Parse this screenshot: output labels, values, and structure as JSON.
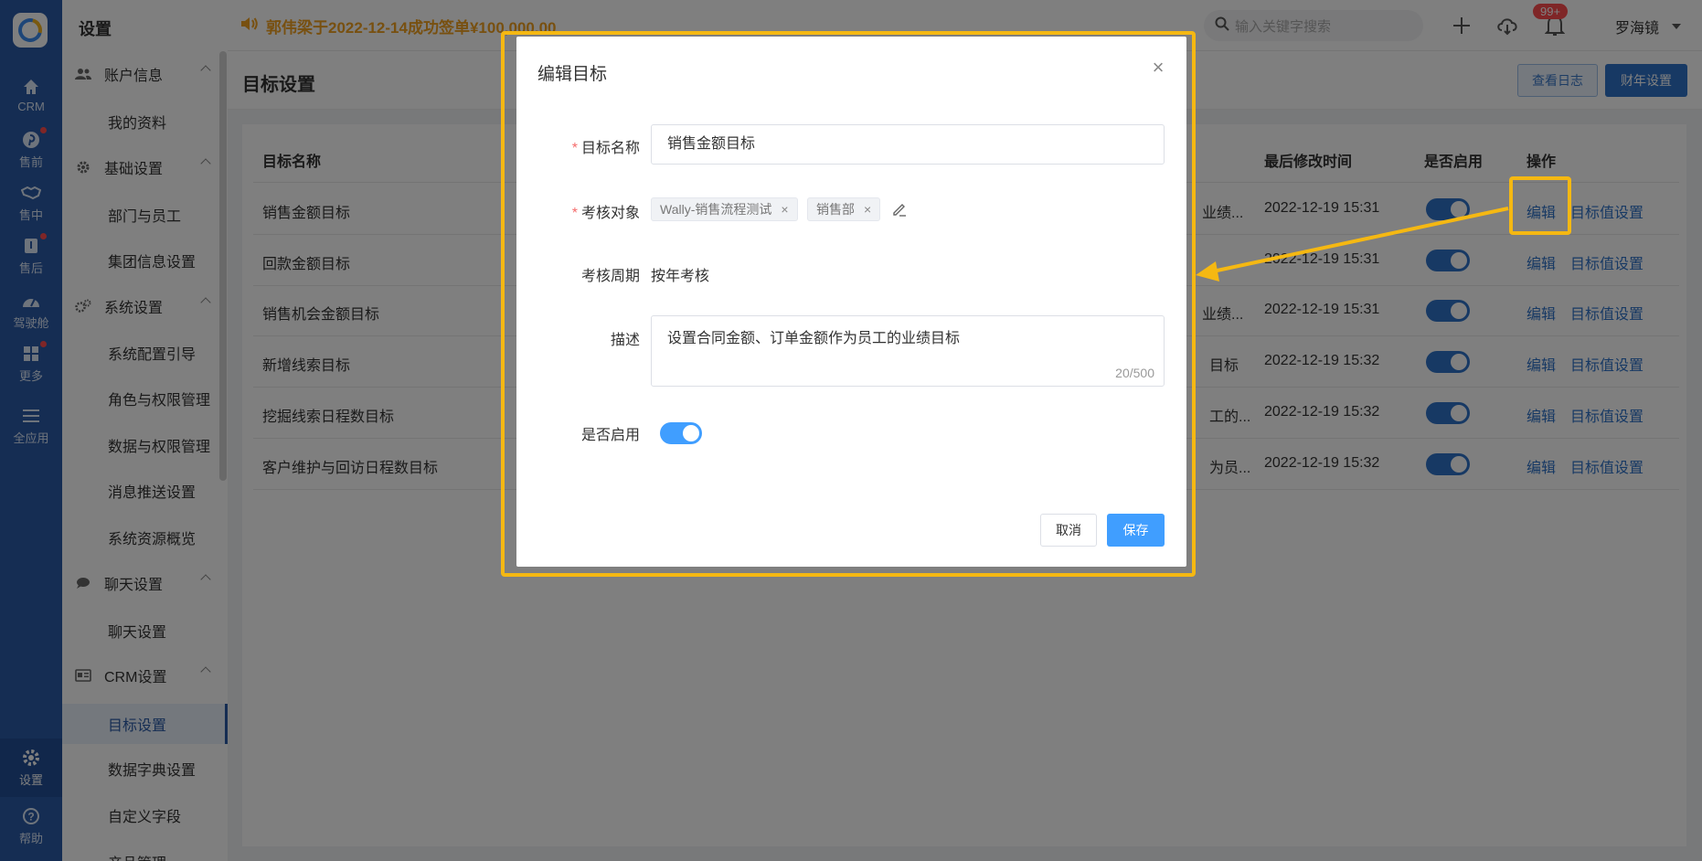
{
  "rail": {
    "items": [
      {
        "label": "CRM",
        "icon": "home-icon",
        "dot": false
      },
      {
        "label": "售前",
        "icon": "pinterest-icon",
        "dot": true
      },
      {
        "label": "售中",
        "icon": "handshake-icon",
        "dot": false
      },
      {
        "label": "售后",
        "icon": "box-icon",
        "dot": true
      },
      {
        "label": "驾驶舱",
        "icon": "dashboard-icon",
        "dot": false
      },
      {
        "label": "更多",
        "icon": "grid-icon",
        "dot": true
      },
      {
        "label": "全应用",
        "icon": "menu-icon",
        "dot": false
      }
    ],
    "settings_label": "设置",
    "help_label": "帮助"
  },
  "sidebar": {
    "title": "设置",
    "groups": [
      {
        "label": "账户信息",
        "icon": "users-icon",
        "items": [
          "我的资料"
        ]
      },
      {
        "label": "基础设置",
        "icon": "gear-icon",
        "items": [
          "部门与员工",
          "集团信息设置"
        ]
      },
      {
        "label": "系统设置",
        "icon": "gears-icon",
        "items": [
          "系统配置引导",
          "角色与权限管理",
          "数据与权限管理",
          "消息推送设置",
          "系统资源概览"
        ]
      },
      {
        "label": "聊天设置",
        "icon": "chat-icon",
        "items": [
          "聊天设置"
        ]
      },
      {
        "label": "CRM设置",
        "icon": "idcard-icon",
        "items": [
          "目标设置",
          "数据字典设置",
          "自定义字段",
          "产品管理"
        ]
      }
    ]
  },
  "topbar": {
    "announcement": "郭伟梁于2022-12-14成功签单¥100,000.00",
    "search_placeholder": "输入关键字搜索",
    "notify_badge": "99+",
    "username": "罗海镜"
  },
  "page": {
    "title": "目标设置",
    "view_log": "查看日志",
    "fiscal_year": "财年设置"
  },
  "table": {
    "headers": {
      "name": "目标名称",
      "updated": "最后修改时间",
      "enabled": "是否启用",
      "actions": "操作"
    },
    "rows": [
      {
        "name": "销售金额目标",
        "desc": "业绩...",
        "updated": "2022-12-19 15:31",
        "edit": "编辑",
        "value": "目标值设置"
      },
      {
        "name": "回款金额目标",
        "desc": "",
        "updated": "2022-12-19 15:31",
        "edit": "编辑",
        "value": "目标值设置"
      },
      {
        "name": "销售机会金额目标",
        "desc": "业绩...",
        "updated": "2022-12-19 15:31",
        "edit": "编辑",
        "value": "目标值设置"
      },
      {
        "name": "新增线索目标",
        "desc": "目标",
        "updated": "2022-12-19 15:32",
        "edit": "编辑",
        "value": "目标值设置"
      },
      {
        "name": "挖掘线索日程数目标",
        "desc": "工的...",
        "updated": "2022-12-19 15:32",
        "edit": "编辑",
        "value": "目标值设置"
      },
      {
        "name": "客户维护与回访日程数目标",
        "desc": "为员...",
        "updated": "2022-12-19 15:32",
        "edit": "编辑",
        "value": "目标值设置"
      }
    ]
  },
  "modal": {
    "title": "编辑目标",
    "fields": {
      "name_label": "目标名称",
      "name_value": "销售金额目标",
      "target_label": "考核对象",
      "tags": [
        "Wally-销售流程测试",
        "销售部"
      ],
      "period_label": "考核周期",
      "period_value": "按年考核",
      "desc_label": "描述",
      "desc_value": "设置合同金额、订单金额作为员工的业绩目标",
      "desc_counter": "20/500",
      "enabled_label": "是否启用"
    },
    "cancel": "取消",
    "save": "保存"
  },
  "colors": {
    "rail": "#2b5aa6",
    "primary": "#409eff",
    "highlight": "#f5b812",
    "announce": "#f0a020"
  }
}
